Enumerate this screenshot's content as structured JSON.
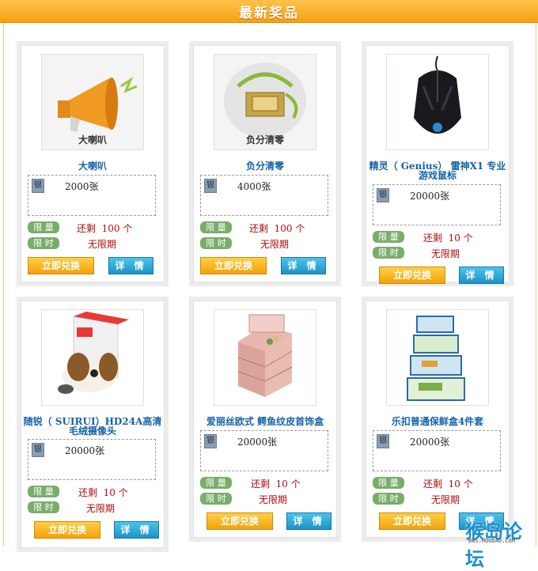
{
  "header": {
    "title": "最新奖品"
  },
  "labels": {
    "limit": "限 量",
    "time": "限 时",
    "exchange": "立即兑换",
    "detail": "详 情",
    "silver": "银"
  },
  "products": [
    {
      "name": "大喇叭",
      "image_caption": "大喇叭",
      "price": "2000张",
      "remaining": "还剩",
      "remaining_count": "100 个",
      "validity": "无限期",
      "icon": "megaphone-icon"
    },
    {
      "name": "负分清零",
      "image_caption": "负分清零",
      "price": "4000张",
      "remaining": "还剩",
      "remaining_count": "100 个",
      "validity": "无限期",
      "icon": "scroll-icon"
    },
    {
      "name": "精灵（ Genius） 雷神X1 专业游戏鼠标",
      "price": "20000张",
      "remaining": "还剩",
      "remaining_count": "10 个",
      "validity": "无限期",
      "icon": "gaming-mouse-icon"
    },
    {
      "name": "随锐（ SUIRUI）HD24A高清毛绒摄像头",
      "price": "20000张",
      "remaining": "还剩",
      "remaining_count": "10 个",
      "validity": "无限期",
      "icon": "plush-dog-webcam-icon"
    },
    {
      "name": "爱丽丝欧式 鳄鱼纹皮首饰盒",
      "price": "20000张",
      "remaining": "还剩",
      "remaining_count": "10 个",
      "validity": "无限期",
      "icon": "jewelry-box-icon"
    },
    {
      "name": "乐扣普通保鲜盒4件套",
      "price": "20000张",
      "remaining": "还剩",
      "remaining_count": "10 个",
      "validity": "无限期",
      "icon": "food-container-icon"
    }
  ],
  "watermark": {
    "text": "猴岛论坛",
    "url": "BBS.HOUDAO.COM"
  },
  "colors": {
    "header": "#f7a012",
    "name": "#1663a8",
    "tag": "#79ad69",
    "exchange": "#f3a20a",
    "detail": "#1e92c8",
    "red": "#b10a0a"
  }
}
